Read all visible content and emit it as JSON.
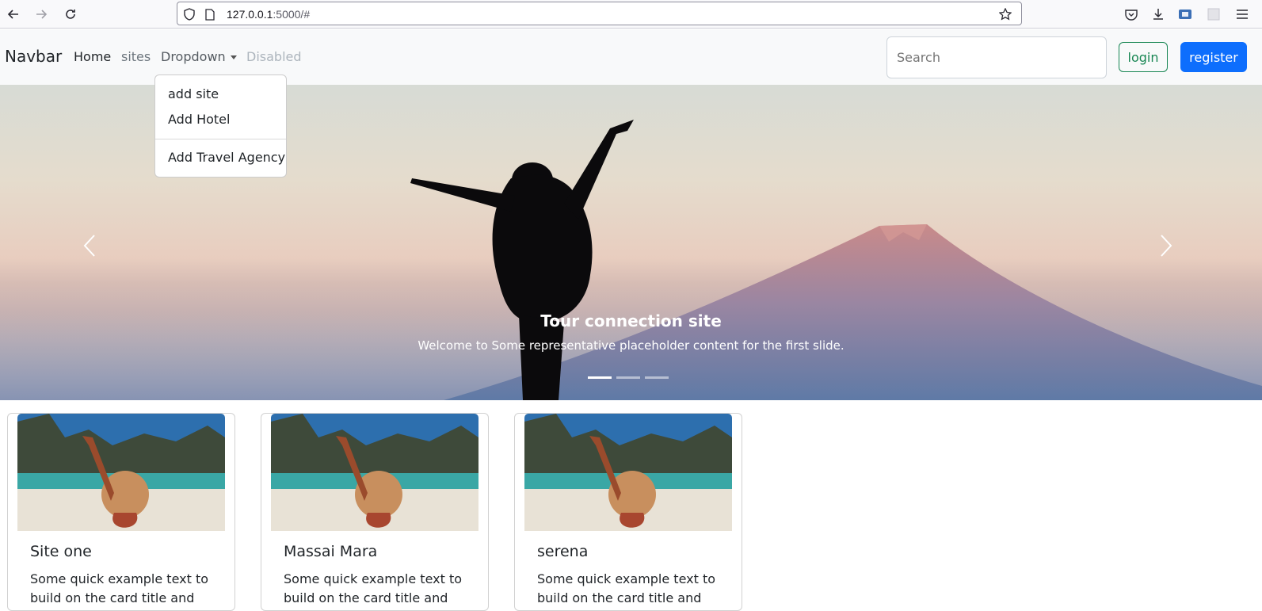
{
  "browser": {
    "url_host": "127.0.0.1",
    "url_rest": ":5000/#",
    "icons": [
      "back-arrow-icon",
      "forward-arrow-icon",
      "reload-icon",
      "shield-icon",
      "page-icon",
      "bookmark-star-icon",
      "pocket-icon",
      "download-icon",
      "extension-icon",
      "screenshot-icon",
      "menu-icon"
    ]
  },
  "navbar": {
    "brand": "Navbar",
    "links": [
      "Home",
      "sites",
      "Dropdown",
      "Disabled"
    ],
    "search_placeholder": "Search",
    "login_label": "login",
    "register_label": "register"
  },
  "dropdown": {
    "items": [
      "add site",
      "Add Hotel",
      "Add Travel Agency"
    ]
  },
  "carousel": {
    "title": "Tour connection site",
    "text": "Welcome to Some representative placeholder content for the first slide.",
    "indicator_count": 3,
    "active_indicator": 1
  },
  "cards": [
    {
      "title": "Site one",
      "text": "Some quick example text to build on the card title and make"
    },
    {
      "title": "Massai Mara",
      "text": "Some quick example text to build on the card title and make"
    },
    {
      "title": "serena",
      "text": "Some quick example text to build on the card title and make"
    }
  ],
  "colors": {
    "primary": "#0d6efd",
    "success": "#198754",
    "navbar_bg": "#f8f9fa"
  }
}
